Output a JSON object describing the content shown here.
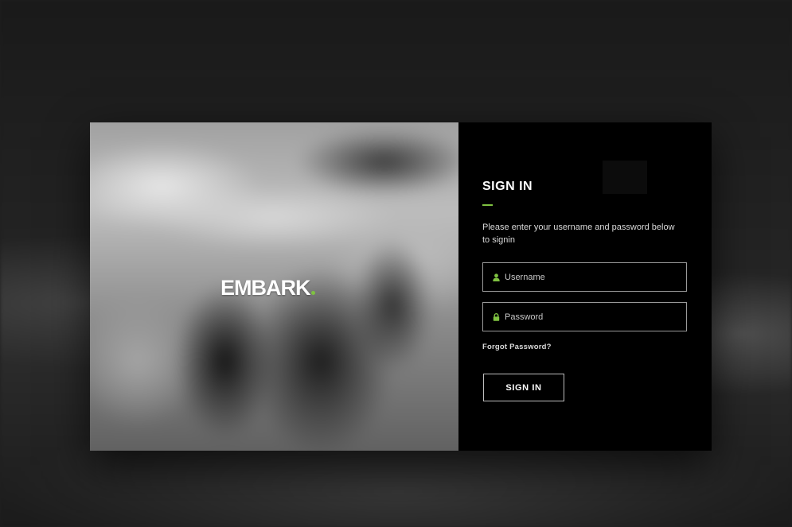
{
  "brand": {
    "logo_text": "EMBARK",
    "accent_color": "#7fc241"
  },
  "form": {
    "title": "SIGN IN",
    "description": "Please enter your username and password below to signin",
    "username": {
      "placeholder": "Username",
      "icon": "user-icon"
    },
    "password": {
      "placeholder": "Password",
      "icon": "lock-icon"
    },
    "forgot_label": "Forgot Password?",
    "submit_label": "SIGN IN"
  }
}
